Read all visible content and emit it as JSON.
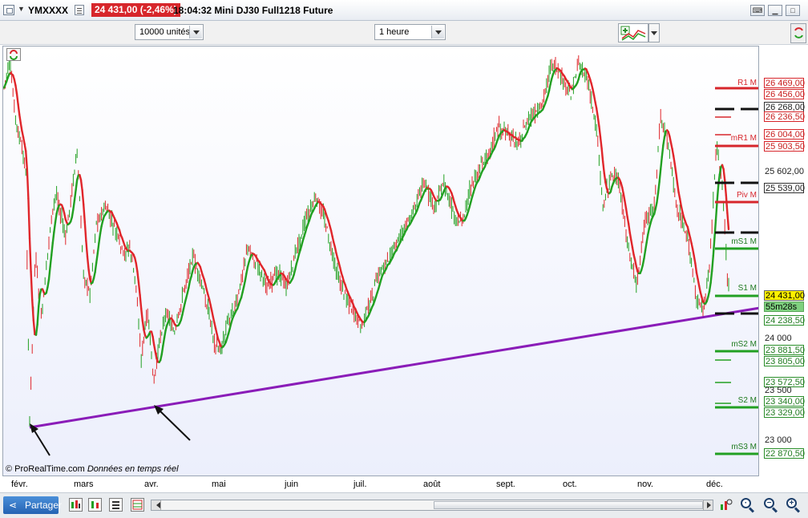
{
  "window": {
    "symbol": "YMXXXX",
    "price_badge": "24 431,00 (-2,46%)",
    "time_and_name": "18:04:32 Mini DJ30 Full1218 Future"
  },
  "toolbar": {
    "units_select": "10000 unités",
    "timeframe_select": "1 heure"
  },
  "chart": {
    "copyright": "© ProRealTime.com",
    "realtime": "Données en temps réel",
    "countdown": "55m28s",
    "current_price": "24 431,00"
  },
  "price_axis": {
    "labels": [
      {
        "text": "26 469,00",
        "style": "box-r"
      },
      {
        "text": "26 456,00",
        "style": "box-r"
      },
      {
        "text": "26 268,00",
        "style": "box-k"
      },
      {
        "text": "26 236,50",
        "style": "box-r"
      },
      {
        "text": "26 004,00",
        "style": "box-r"
      },
      {
        "text": "25 903,50",
        "style": "box-r"
      },
      {
        "text": "25 602,00",
        "style": "plain"
      },
      {
        "text": "25 539,00",
        "style": "box-k"
      },
      {
        "text": "24 238,50",
        "style": "box-g"
      },
      {
        "text": "24 000",
        "style": "plain"
      },
      {
        "text": "23 881,50",
        "style": "box-g"
      },
      {
        "text": "23 805,00",
        "style": "box-g"
      },
      {
        "text": "23 572,50",
        "style": "box-g"
      },
      {
        "text": "23 500",
        "style": "plain"
      },
      {
        "text": "23 340,00",
        "style": "box-g"
      },
      {
        "text": "23 329,00",
        "style": "box-g"
      },
      {
        "text": "23 000",
        "style": "plain"
      },
      {
        "text": "22 870,50",
        "style": "box-g"
      }
    ],
    "pivot_labels": [
      {
        "text": "R1 M",
        "color": "#d7262b"
      },
      {
        "text": "mR1 M",
        "color": "#d7262b"
      },
      {
        "text": "Piv M",
        "color": "#d7262b"
      },
      {
        "text": "mS1 M",
        "color": "#1f7a1f"
      },
      {
        "text": "S1 M",
        "color": "#1f7a1f"
      },
      {
        "text": "mS2 M",
        "color": "#1f7a1f"
      },
      {
        "text": "S2 M",
        "color": "#1f7a1f"
      },
      {
        "text": "mS3 M",
        "color": "#1f7a1f"
      }
    ]
  },
  "date_axis": [
    "févr.",
    "mars",
    "avr.",
    "mai",
    "juin",
    "juil.",
    "août",
    "sept.",
    "oct.",
    "nov.",
    "déc."
  ],
  "bottom": {
    "share_label": "Partager"
  },
  "colors": {
    "up": "#22a022",
    "down": "#e0262b",
    "trendline": "#8a1cb8",
    "price_badge": "#d7262b"
  }
}
